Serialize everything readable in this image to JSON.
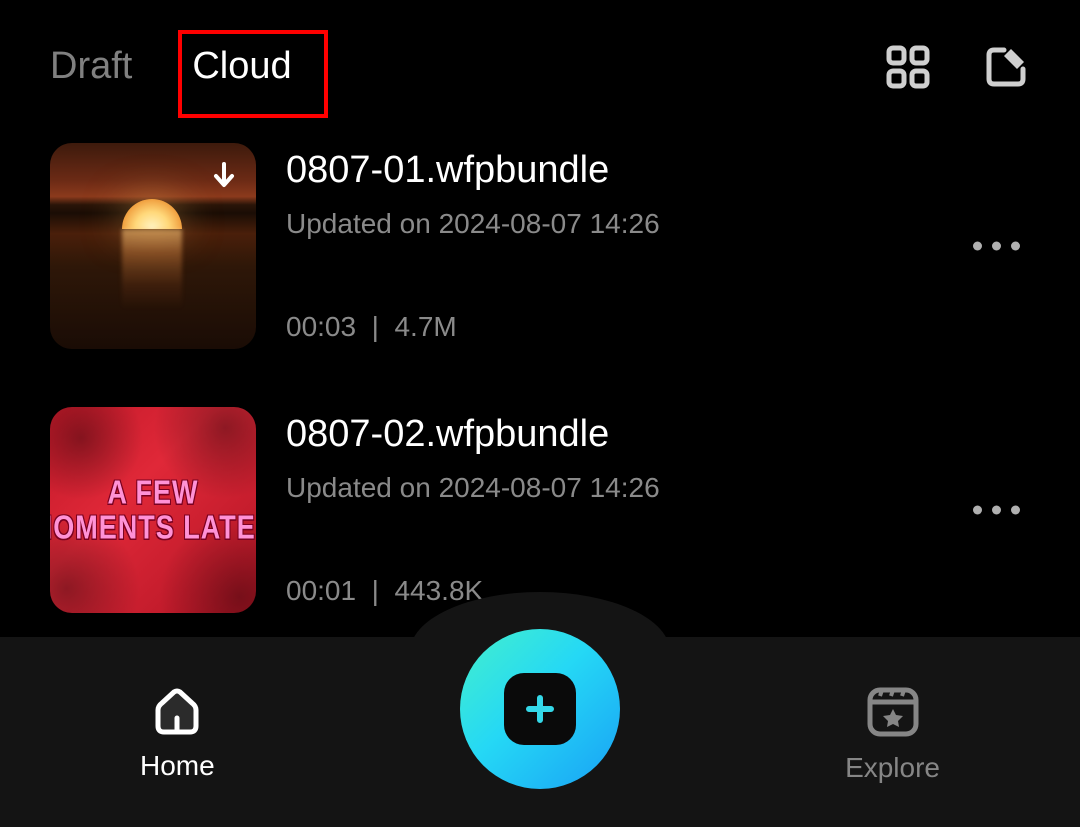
{
  "tabs": {
    "draft": "Draft",
    "cloud": "Cloud",
    "active": "cloud"
  },
  "files": [
    {
      "name": "0807-01.wfpbundle",
      "updated": "Updated on 2024-08-07 14:26",
      "duration": "00:03",
      "size": "4.7M",
      "downloadable": true,
      "thumb": "sunset"
    },
    {
      "name": "0807-02.wfpbundle",
      "updated": "Updated on 2024-08-07 14:26",
      "duration": "00:01",
      "size": "443.8K",
      "downloadable": false,
      "thumb": "red",
      "thumbText": "A FEW\nMOMENTS LATER"
    }
  ],
  "nav": {
    "home": "Home",
    "explore": "Explore"
  }
}
